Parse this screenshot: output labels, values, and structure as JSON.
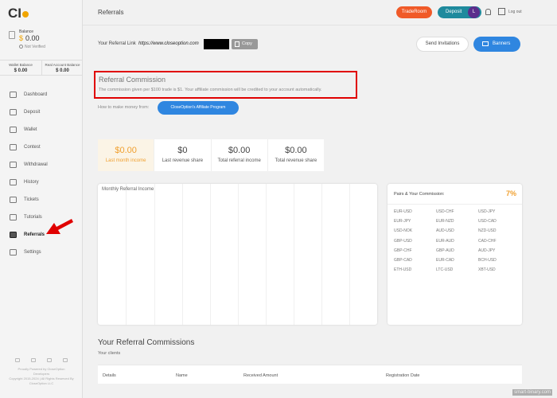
{
  "brand": {
    "logo_text": "CI",
    "accent": "#f0a500"
  },
  "sidebar": {
    "balance_label": "Balance",
    "balance_currency": "$",
    "balance_amount": "0.00",
    "verification": "Not Verified",
    "wallet_balance_label": "Wallet Balance",
    "wallet_balance_value": "$ 0.00",
    "real_account_label": "Real Account Balance",
    "real_account_value": "$ 0.00",
    "items": [
      {
        "label": "Dashboard",
        "icon": "dashboard-icon"
      },
      {
        "label": "Deposit",
        "icon": "deposit-icon"
      },
      {
        "label": "Wallet",
        "icon": "wallet-icon"
      },
      {
        "label": "Contest",
        "icon": "trophy-icon"
      },
      {
        "label": "Withdrawal",
        "icon": "withdrawal-icon"
      },
      {
        "label": "History",
        "icon": "history-icon"
      },
      {
        "label": "Tickets",
        "icon": "ticket-icon"
      },
      {
        "label": "Tutorials",
        "icon": "tutorials-icon"
      },
      {
        "label": "Referrals",
        "icon": "referrals-icon",
        "active": true
      },
      {
        "label": "Settings",
        "icon": "settings-icon"
      }
    ],
    "footer_line1": "Proudly Powered by CloseOption",
    "footer_line2": "Developers",
    "footer_line3": "Copyright 2015-2024 | All Rights Reserved By",
    "footer_line4": "CloseOption LLC"
  },
  "topbar": {
    "title": "Referrals",
    "traderoom": "TradeRoom",
    "deposit": "Deposit",
    "avatar_initial": "L",
    "logout": "Log out"
  },
  "referral": {
    "link_label": "Your Referral Link",
    "link_url": "https://www.closeoption.com",
    "copy": "Copy",
    "send_invitations": "Send Invitations",
    "banners": "Banners"
  },
  "commission": {
    "title": "Referral Commission",
    "text": "The commission given per $100 trade is $1. Your affiliate commission will be credited to your account automatically.",
    "howto_label": "How to make money from:",
    "program_button": "CloseOption's Affiliate Program"
  },
  "stats": [
    {
      "value": "$0.00",
      "label": "Last month income"
    },
    {
      "value": "$0",
      "label": "Last revenue share"
    },
    {
      "value": "$0.00",
      "label": "Total referral income"
    },
    {
      "value": "$0.00",
      "label": "Total revenue share"
    }
  ],
  "chart": {
    "title": "Monthly Referral Income"
  },
  "pairs": {
    "title": "Pairs & Your Commission:",
    "percent": "7%",
    "list": [
      "EUR-USD",
      "USD-CHF",
      "USD-JPY",
      "EUR-JPY",
      "EUR-NZD",
      "USD-CAD",
      "USD-NOK",
      "AUD-USD",
      "NZD-USD",
      "GBP-USD",
      "EUR-AUD",
      "CAD-CHF",
      "GBP-CHF",
      "GBP-AUD",
      "AUD-JPY",
      "GBP-CAD",
      "EUR-CAD",
      "BCH-USD",
      "ETH-USD",
      "LTC-USD",
      "XBT-USD"
    ]
  },
  "commissions_section": {
    "title": "Your Referral Commissions",
    "subtitle": "Your clients",
    "columns": [
      "Details",
      "Name",
      "Received Amount",
      "Registration Date"
    ]
  },
  "watermark": "smart-binary.com"
}
